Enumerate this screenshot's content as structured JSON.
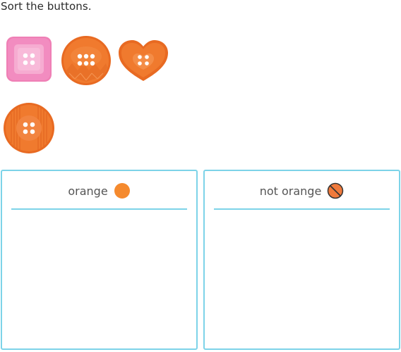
{
  "prompt": "Sort the buttons.",
  "buttons": [
    {
      "shape": "square",
      "color": "#ef7fb5",
      "holes": 4
    },
    {
      "shape": "circle",
      "color": "#f07a2e",
      "holes": 6
    },
    {
      "shape": "heart",
      "color": "#f07a2e",
      "holes": 4
    },
    {
      "shape": "circle",
      "color": "#f07a2e",
      "holes": 4
    }
  ],
  "bins": [
    {
      "label": "orange",
      "icon": "orange-circle-icon",
      "color": "#f58a2e"
    },
    {
      "label": "not orange",
      "icon": "not-orange-icon",
      "color": "#f07a3c"
    }
  ],
  "colors": {
    "border": "#7dd3e8",
    "orange": "#f07a2e",
    "pink": "#ef7fb5"
  }
}
